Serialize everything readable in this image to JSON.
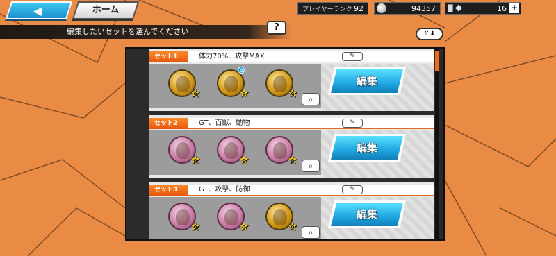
{
  "nav": {
    "back_icon": "back-arrow-icon",
    "back_arrow": "◀",
    "home_label": "ホーム"
  },
  "status": {
    "rank_label": "プレイヤーランク",
    "rank_value": "92",
    "zeni_value": "94357",
    "gem_value": "16",
    "plus_label": "+"
  },
  "instruction": "編集したいセットを選んでください",
  "help_label": "?",
  "sort_label": "⇧⬇",
  "colors": {
    "accent": "#f06a1a",
    "edit_button": "#1ea7e0",
    "background": "#e98a45"
  },
  "sets": [
    {
      "tag": "セット1",
      "name": "体力70%、攻撃MAX",
      "edit_label": "編集",
      "medals": [
        {
          "type": "gold",
          "stars": "9"
        },
        {
          "type": "gold",
          "stars": "9",
          "badge": "α"
        },
        {
          "type": "gold",
          "stars": "9"
        }
      ]
    },
    {
      "tag": "セット2",
      "name": "GT、百獣、動物",
      "edit_label": "編集",
      "medals": [
        {
          "type": "pink",
          "stars": "9"
        },
        {
          "type": "pink",
          "stars": "9"
        },
        {
          "type": "pink",
          "stars": "9"
        }
      ]
    },
    {
      "tag": "セット3",
      "name": "GT、攻撃、防御",
      "edit_label": "編集",
      "medals": [
        {
          "type": "pink",
          "stars": "9"
        },
        {
          "type": "pink",
          "stars": "9"
        },
        {
          "type": "gold",
          "stars": "9"
        }
      ]
    }
  ]
}
